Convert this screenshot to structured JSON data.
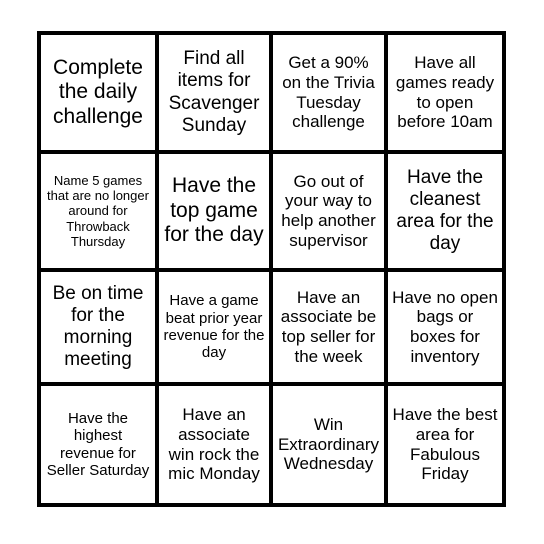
{
  "card": {
    "type": "bingo-card",
    "rows": 4,
    "columns": 4,
    "background_color": "#ffffff",
    "border_color": "#000000",
    "text_color": "#000000",
    "cells": [
      {
        "text": "Complete the daily challenge",
        "size": "fs-xl"
      },
      {
        "text": "Find all items for Scavenger Sunday",
        "size": "fs-lg"
      },
      {
        "text": "Get a 90% on the Trivia Tuesday challenge",
        "size": "fs-md"
      },
      {
        "text": "Have all games ready to open before 10am",
        "size": "fs-md"
      },
      {
        "text": "Name 5 games that are no longer around for Throwback Thursday",
        "size": "fs-xs"
      },
      {
        "text": "Have the top game for the day",
        "size": "fs-xl"
      },
      {
        "text": "Go out of your way to help another supervisor",
        "size": "fs-md"
      },
      {
        "text": "Have the cleanest area for the day",
        "size": "fs-lg"
      },
      {
        "text": "Be on time for the morning meeting",
        "size": "fs-lg"
      },
      {
        "text": "Have a game beat prior year revenue for the day",
        "size": "fs-sm"
      },
      {
        "text": "Have an associate be top seller for the week",
        "size": "fs-md"
      },
      {
        "text": "Have no open bags or boxes for inventory",
        "size": "fs-md"
      },
      {
        "text": "Have the highest revenue for Seller Saturday",
        "size": "fs-sm"
      },
      {
        "text": "Have an associate win rock the mic Monday",
        "size": "fs-md"
      },
      {
        "text": "Win Extraordinary Wednesday",
        "size": "fs-md"
      },
      {
        "text": "Have the best area for Fabulous Friday",
        "size": "fs-md"
      }
    ]
  }
}
